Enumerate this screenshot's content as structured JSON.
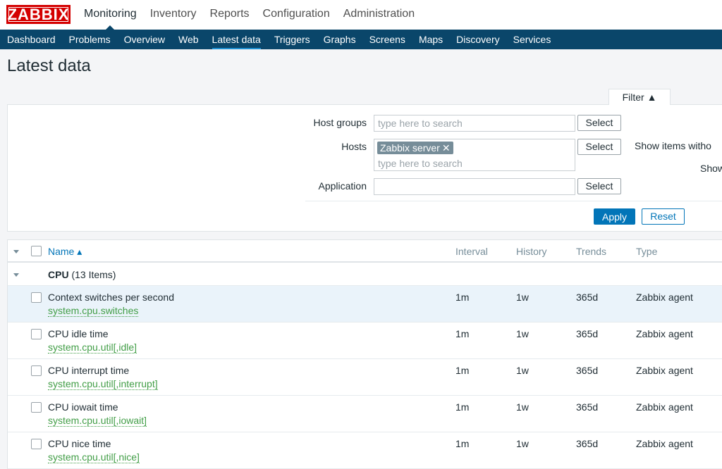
{
  "logo": "ZABBIX",
  "top_menu": [
    "Monitoring",
    "Inventory",
    "Reports",
    "Configuration",
    "Administration"
  ],
  "sub_menu": [
    "Dashboard",
    "Problems",
    "Overview",
    "Web",
    "Latest data",
    "Triggers",
    "Graphs",
    "Screens",
    "Maps",
    "Discovery",
    "Services"
  ],
  "page_title": "Latest data",
  "filter": {
    "tab_label": "Filter ▲",
    "host_groups_label": "Host groups",
    "host_groups_placeholder": "type here to search",
    "hosts_label": "Hosts",
    "hosts_tag": "Zabbix server",
    "hosts_placeholder": "type here to search",
    "application_label": "Application",
    "application_value": "",
    "select_label": "Select",
    "show_items_label": "Show items witho",
    "show_label": "Show",
    "apply_label": "Apply",
    "reset_label": "Reset"
  },
  "table": {
    "headers": {
      "name": "Name ▴",
      "interval": "Interval",
      "history": "History",
      "trends": "Trends",
      "type": "Type"
    },
    "group": {
      "name": "CPU",
      "count": "(13 Items)"
    },
    "rows": [
      {
        "name": "Context switches per second",
        "key": "system.cpu.switches",
        "interval": "1m",
        "history": "1w",
        "trends": "365d",
        "type": "Zabbix agent"
      },
      {
        "name": "CPU idle time",
        "key": "system.cpu.util[,idle]",
        "interval": "1m",
        "history": "1w",
        "trends": "365d",
        "type": "Zabbix agent"
      },
      {
        "name": "CPU interrupt time",
        "key": "system.cpu.util[,interrupt]",
        "interval": "1m",
        "history": "1w",
        "trends": "365d",
        "type": "Zabbix agent"
      },
      {
        "name": "CPU iowait time",
        "key": "system.cpu.util[,iowait]",
        "interval": "1m",
        "history": "1w",
        "trends": "365d",
        "type": "Zabbix agent"
      },
      {
        "name": "CPU nice time",
        "key": "system.cpu.util[,nice]",
        "interval": "1m",
        "history": "1w",
        "trends": "365d",
        "type": "Zabbix agent"
      }
    ]
  }
}
